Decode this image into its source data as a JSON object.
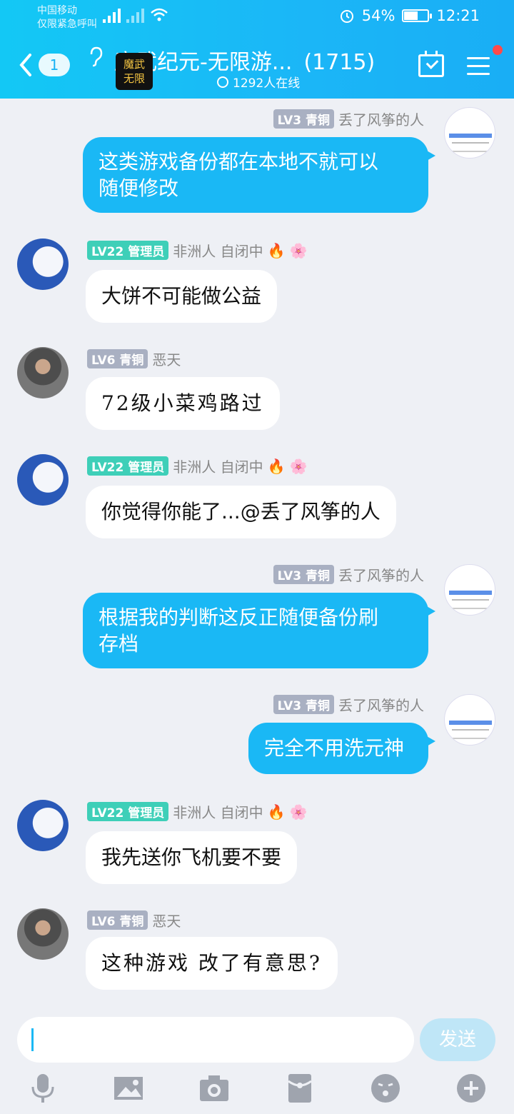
{
  "status": {
    "carrier": "中国移动",
    "carrier_sub": "仅限紧急呼叫",
    "network": "4G",
    "battery": "54%",
    "battery_level": 0.54,
    "time": "12:21"
  },
  "header": {
    "back_count": "1",
    "title": "魔武纪元-无限游...",
    "member_count": "(1715)",
    "online": "1292人在线",
    "logo_text_1": "魔武",
    "logo_text_2": "无限",
    "accent": "#1ab8f5"
  },
  "messages": [
    {
      "side": "out",
      "level": "LV3",
      "rank": "青铜",
      "name": "丢了风筝的人",
      "lines": [
        "这类游戏备份都在本地不就可以",
        "随便修改"
      ]
    },
    {
      "side": "in",
      "avatar": "moon",
      "level": "LV22",
      "rank": "管理员",
      "name": "非洲人 自闭中",
      "lines": [
        "大饼不可能做公益"
      ]
    },
    {
      "side": "in",
      "avatar": "man",
      "level": "LV6",
      "rank": "青铜",
      "name": "恶天",
      "lines": [
        "72级小菜鸡路过"
      ]
    },
    {
      "side": "in",
      "avatar": "moon",
      "level": "LV22",
      "rank": "管理员",
      "name": "非洲人 自闭中",
      "lines": [
        "你觉得你能了...@丢了风筝的人"
      ]
    },
    {
      "side": "out",
      "level": "LV3",
      "rank": "青铜",
      "name": "丢了风筝的人",
      "lines": [
        "根据我的判断这反正随便备份刷",
        "存档"
      ]
    },
    {
      "side": "out",
      "level": "LV3",
      "rank": "青铜",
      "name": "丢了风筝的人",
      "lines": [
        "完全不用洗元神"
      ]
    },
    {
      "side": "in",
      "avatar": "moon",
      "level": "LV22",
      "rank": "管理员",
      "name": "非洲人 自闭中",
      "lines": [
        "我先送你飞机要不要"
      ]
    },
    {
      "side": "in",
      "avatar": "man",
      "level": "LV6",
      "rank": "青铜",
      "name": "恶天",
      "lines": [
        "这种游戏 改了有意思?"
      ]
    }
  ],
  "input": {
    "send_label": "发送"
  },
  "toolbar": [
    "mic-icon",
    "image-icon",
    "camera-icon",
    "red-packet-icon",
    "emoji-icon",
    "plus-icon"
  ]
}
